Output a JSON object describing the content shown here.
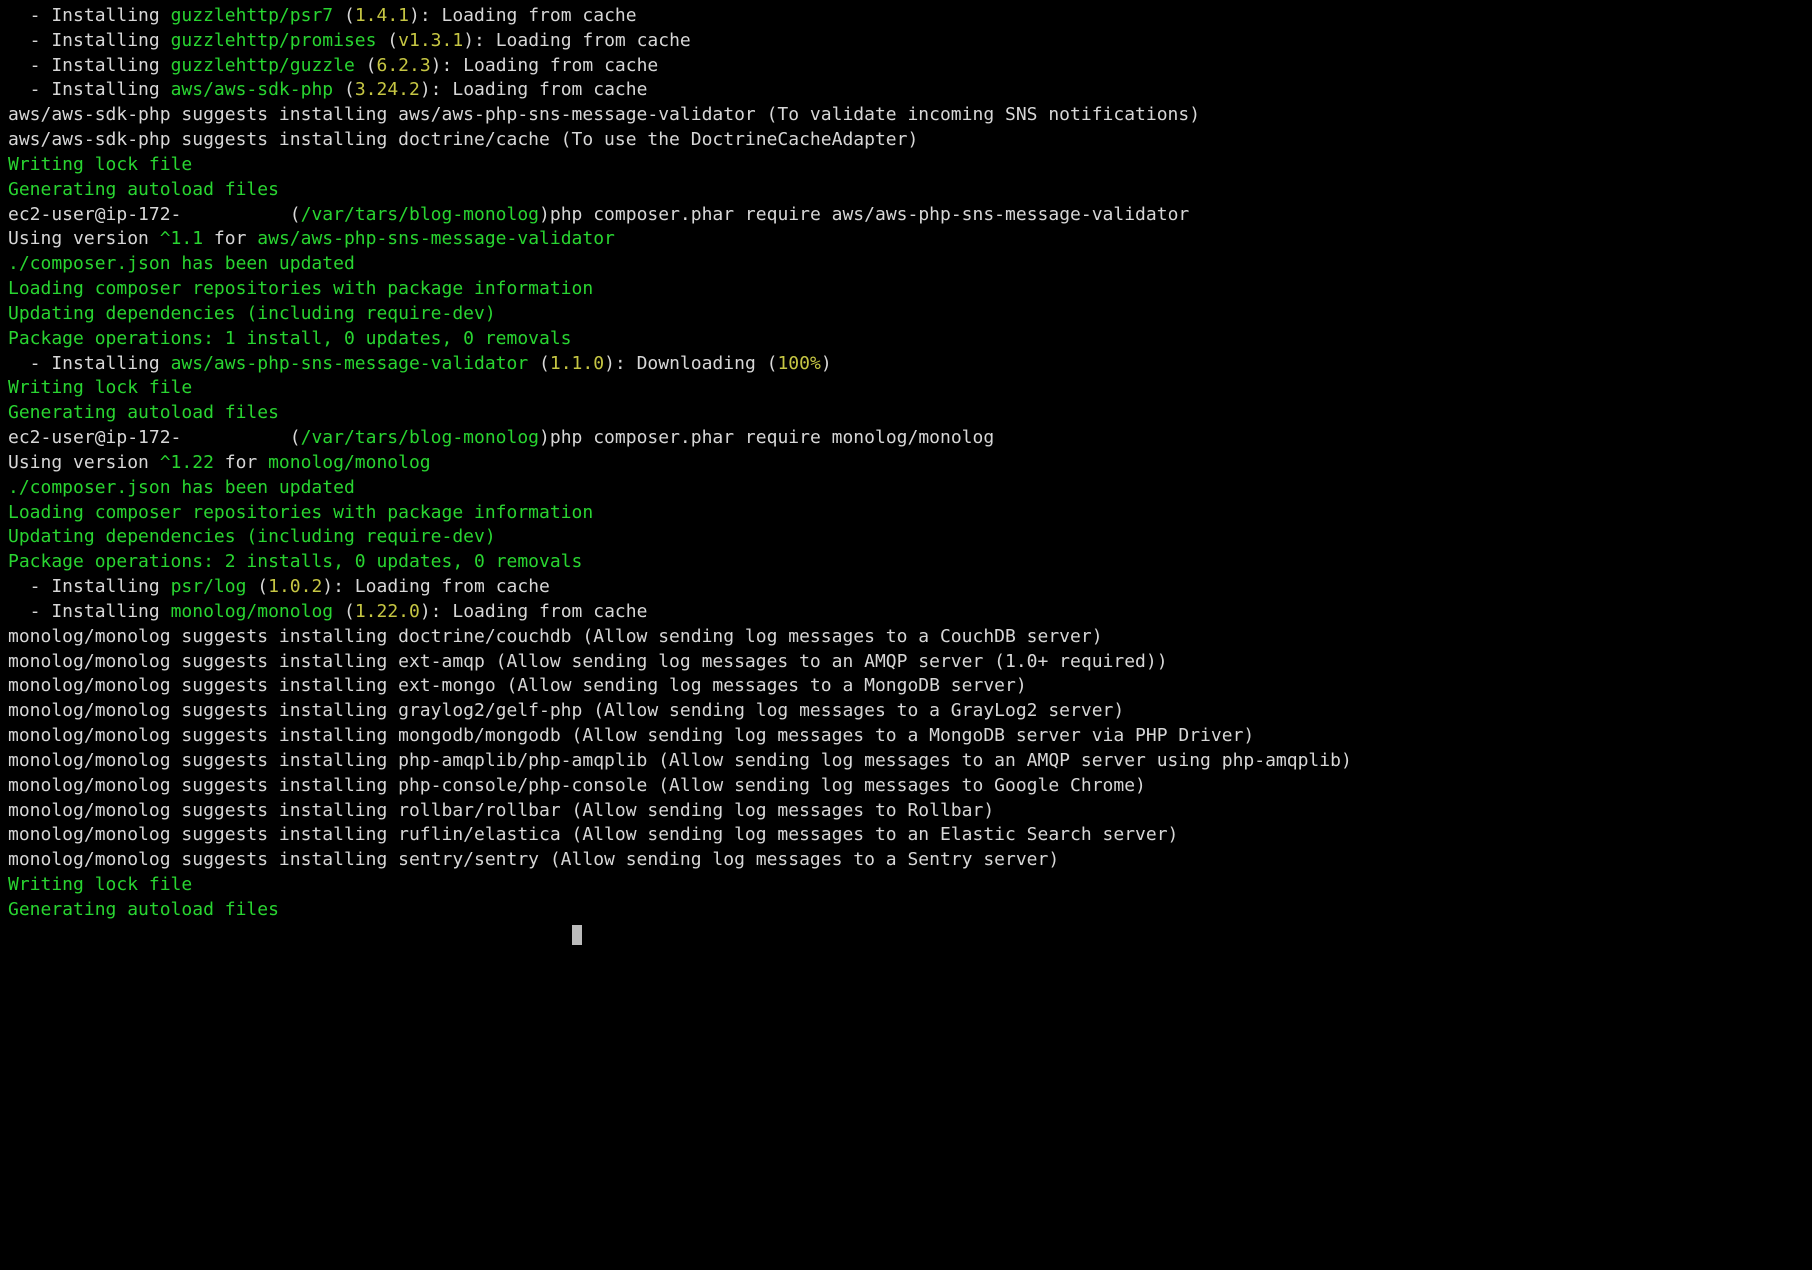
{
  "lines": [
    [
      {
        "t": "  - Installing ",
        "c": "white"
      },
      {
        "t": "guzzlehttp/psr7",
        "c": "green"
      },
      {
        "t": " (",
        "c": "white"
      },
      {
        "t": "1.4.1",
        "c": "yellow"
      },
      {
        "t": "): Loading from cache",
        "c": "white"
      }
    ],
    [
      {
        "t": "  - Installing ",
        "c": "white"
      },
      {
        "t": "guzzlehttp/promises",
        "c": "green"
      },
      {
        "t": " (",
        "c": "white"
      },
      {
        "t": "v1.3.1",
        "c": "yellow"
      },
      {
        "t": "): Loading from cache",
        "c": "white"
      }
    ],
    [
      {
        "t": "  - Installing ",
        "c": "white"
      },
      {
        "t": "guzzlehttp/guzzle",
        "c": "green"
      },
      {
        "t": " (",
        "c": "white"
      },
      {
        "t": "6.2.3",
        "c": "yellow"
      },
      {
        "t": "): Loading from cache",
        "c": "white"
      }
    ],
    [
      {
        "t": "  - Installing ",
        "c": "white"
      },
      {
        "t": "aws/aws-sdk-php",
        "c": "green"
      },
      {
        "t": " (",
        "c": "white"
      },
      {
        "t": "3.24.2",
        "c": "yellow"
      },
      {
        "t": "): Loading from cache",
        "c": "white"
      }
    ],
    [
      {
        "t": "aws/aws-sdk-php suggests installing aws/aws-php-sns-message-validator (To validate incoming SNS notifications)",
        "c": "white"
      }
    ],
    [
      {
        "t": "aws/aws-sdk-php suggests installing doctrine/cache (To use the DoctrineCacheAdapter)",
        "c": "white"
      }
    ],
    [
      {
        "t": "Writing lock file",
        "c": "green"
      }
    ],
    [
      {
        "t": "Generating autoload files",
        "c": "green"
      }
    ],
    [
      {
        "t": "ec2-user@ip-172-          (",
        "c": "white"
      },
      {
        "t": "/var/tars/blog-monolog",
        "c": "green"
      },
      {
        "t": ")php composer.phar require aws/aws-php-sns-message-validator",
        "c": "white"
      }
    ],
    [
      {
        "t": "Using version ",
        "c": "white"
      },
      {
        "t": "^1.1",
        "c": "green"
      },
      {
        "t": " for ",
        "c": "white"
      },
      {
        "t": "aws/aws-php-sns-message-validator",
        "c": "green"
      }
    ],
    [
      {
        "t": "./composer.json has been updated",
        "c": "green"
      }
    ],
    [
      {
        "t": "Loading composer repositories with package information",
        "c": "green"
      }
    ],
    [
      {
        "t": "Updating dependencies (including require-dev)",
        "c": "green"
      }
    ],
    [
      {
        "t": "Package operations: 1 install, 0 updates, 0 removals",
        "c": "green"
      }
    ],
    [
      {
        "t": "  - Installing ",
        "c": "white"
      },
      {
        "t": "aws/aws-php-sns-message-validator",
        "c": "green"
      },
      {
        "t": " (",
        "c": "white"
      },
      {
        "t": "1.1.0",
        "c": "yellow"
      },
      {
        "t": "): Downloading (",
        "c": "white"
      },
      {
        "t": "100%",
        "c": "yellow"
      },
      {
        "t": ")",
        "c": "white"
      }
    ],
    [
      {
        "t": "Writing lock file",
        "c": "green"
      }
    ],
    [
      {
        "t": "Generating autoload files",
        "c": "green"
      }
    ],
    [
      {
        "t": "ec2-user@ip-172-          (",
        "c": "white"
      },
      {
        "t": "/var/tars/blog-monolog",
        "c": "green"
      },
      {
        "t": ")php composer.phar require monolog/monolog",
        "c": "white"
      }
    ],
    [
      {
        "t": "Using version ",
        "c": "white"
      },
      {
        "t": "^1.22",
        "c": "green"
      },
      {
        "t": " for ",
        "c": "white"
      },
      {
        "t": "monolog/monolog",
        "c": "green"
      }
    ],
    [
      {
        "t": "./composer.json has been updated",
        "c": "green"
      }
    ],
    [
      {
        "t": "Loading composer repositories with package information",
        "c": "green"
      }
    ],
    [
      {
        "t": "Updating dependencies (including require-dev)",
        "c": "green"
      }
    ],
    [
      {
        "t": "Package operations: 2 installs, 0 updates, 0 removals",
        "c": "green"
      }
    ],
    [
      {
        "t": "  - Installing ",
        "c": "white"
      },
      {
        "t": "psr/log",
        "c": "green"
      },
      {
        "t": " (",
        "c": "white"
      },
      {
        "t": "1.0.2",
        "c": "yellow"
      },
      {
        "t": "): Loading from cache",
        "c": "white"
      }
    ],
    [
      {
        "t": "  - Installing ",
        "c": "white"
      },
      {
        "t": "monolog/monolog",
        "c": "green"
      },
      {
        "t": " (",
        "c": "white"
      },
      {
        "t": "1.22.0",
        "c": "yellow"
      },
      {
        "t": "): Loading from cache",
        "c": "white"
      }
    ],
    [
      {
        "t": "monolog/monolog suggests installing doctrine/couchdb (Allow sending log messages to a CouchDB server)",
        "c": "white"
      }
    ],
    [
      {
        "t": "monolog/monolog suggests installing ext-amqp (Allow sending log messages to an AMQP server (1.0+ required))",
        "c": "white"
      }
    ],
    [
      {
        "t": "monolog/monolog suggests installing ext-mongo (Allow sending log messages to a MongoDB server)",
        "c": "white"
      }
    ],
    [
      {
        "t": "monolog/monolog suggests installing graylog2/gelf-php (Allow sending log messages to a GrayLog2 server)",
        "c": "white"
      }
    ],
    [
      {
        "t": "monolog/monolog suggests installing mongodb/mongodb (Allow sending log messages to a MongoDB server via PHP Driver)",
        "c": "white"
      }
    ],
    [
      {
        "t": "monolog/monolog suggests installing php-amqplib/php-amqplib (Allow sending log messages to an AMQP server using php-amqplib)",
        "c": "white"
      }
    ],
    [
      {
        "t": "monolog/monolog suggests installing php-console/php-console (Allow sending log messages to Google Chrome)",
        "c": "white"
      }
    ],
    [
      {
        "t": "monolog/monolog suggests installing rollbar/rollbar (Allow sending log messages to Rollbar)",
        "c": "white"
      }
    ],
    [
      {
        "t": "monolog/monolog suggests installing ruflin/elastica (Allow sending log messages to an Elastic Search server)",
        "c": "white"
      }
    ],
    [
      {
        "t": "monolog/monolog suggests installing sentry/sentry (Allow sending log messages to a Sentry server)",
        "c": "white"
      }
    ],
    [
      {
        "t": "Writing lock file",
        "c": "green"
      }
    ],
    [
      {
        "t": "Generating autoload files",
        "c": "green"
      }
    ]
  ]
}
